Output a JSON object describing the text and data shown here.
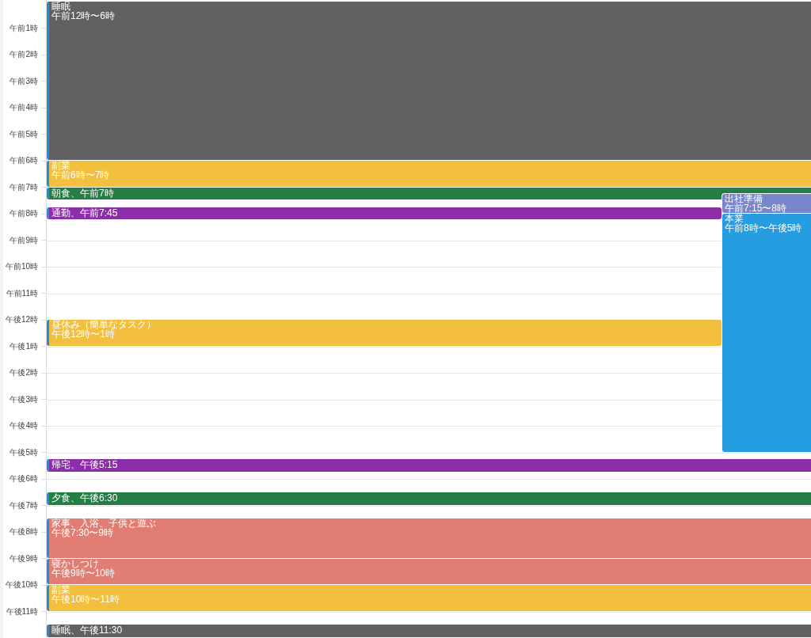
{
  "time_labels": [
    "午前1時",
    "午前2時",
    "午前3時",
    "午前4時",
    "午前5時",
    "午前6時",
    "午前7時",
    "午前8時",
    "午前9時",
    "午前10時",
    "午前11時",
    "午後12時",
    "午後1時",
    "午後2時",
    "午後3時",
    "午後4時",
    "午後5時",
    "午後6時",
    "午後7時",
    "午後8時",
    "午後9時",
    "午後10時",
    "午後11時"
  ],
  "events": [
    {
      "kind": "block",
      "title": "睡眠",
      "time": "午前12時〜6時",
      "color": "#616161"
    },
    {
      "kind": "block",
      "title": "副業",
      "time": "午前6時〜7時",
      "color": "#f2bf3f"
    },
    {
      "kind": "compact",
      "label": "朝食、午前7時",
      "color": "#267e47"
    },
    {
      "kind": "block",
      "title": "出社準備",
      "time": "午前7:15〜8時",
      "color": "#7986cb"
    },
    {
      "kind": "compact",
      "label": "通勤、午前7:45",
      "color": "#8c2ea8"
    },
    {
      "kind": "block",
      "title": "本業",
      "time": "午前8時〜午後5時",
      "color": "#269ce1"
    },
    {
      "kind": "block",
      "title": "昼休み（簡単なタスク）",
      "time": "午後12時〜1時",
      "color": "#f2bf3f"
    },
    {
      "kind": "compact",
      "label": "帰宅、午後5:15",
      "color": "#8c2ea8"
    },
    {
      "kind": "compact",
      "label": "夕食、午後6:30",
      "color": "#267e47"
    },
    {
      "kind": "block",
      "title": "家事、入浴、子供と遊ぶ",
      "time": "午後7:30〜9時",
      "color": "#e27d74"
    },
    {
      "kind": "block",
      "title": "寝かしつけ",
      "time": "午後9時〜10時",
      "color": "#e27d74"
    },
    {
      "kind": "block",
      "title": "副業",
      "time": "午後10時〜11時",
      "color": "#f2bf3f"
    },
    {
      "kind": "compact",
      "label": "睡眠、午後11:30",
      "color": "#616161"
    }
  ]
}
